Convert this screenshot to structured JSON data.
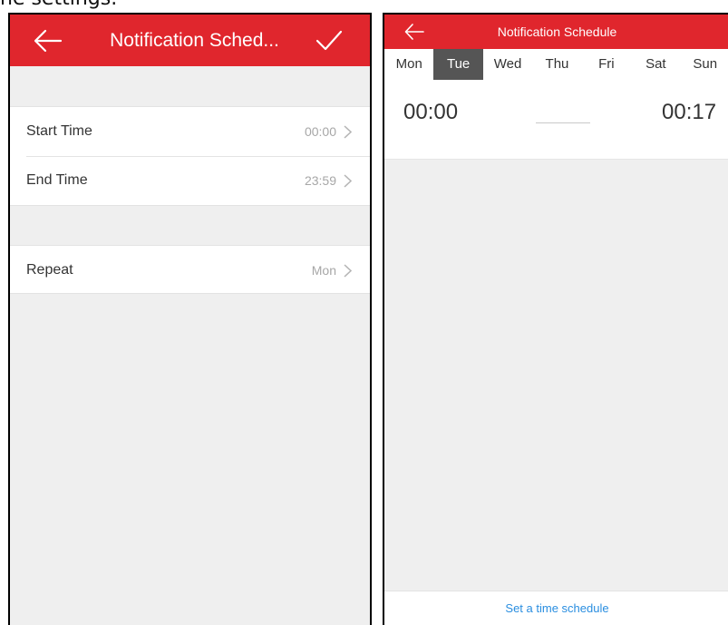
{
  "caption": "he settings.",
  "left_screen": {
    "title": "Notification Sched...",
    "settings": [
      {
        "label": "Start Time",
        "value": "00:00"
      },
      {
        "label": "End Time",
        "value": "23:59"
      },
      {
        "label": "Repeat",
        "value": "Mon"
      }
    ]
  },
  "right_screen": {
    "title": "Notification Schedule",
    "days": [
      "Mon",
      "Tue",
      "Wed",
      "Thu",
      "Fri",
      "Sat",
      "Sun"
    ],
    "selected_day": "Tue",
    "start_time": "00:00",
    "end_time": "00:17",
    "bottom_action": "Set a time schedule"
  },
  "colors": {
    "header_red": "#e0262d",
    "selected_day_bg": "#555555",
    "link_blue": "#2a8ee0"
  },
  "icons": [
    "back-arrow-icon",
    "checkmark-icon",
    "chevron-right-icon"
  ]
}
